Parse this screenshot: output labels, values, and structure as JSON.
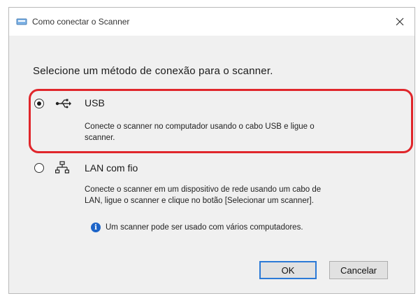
{
  "window": {
    "title": "Como conectar o Scanner",
    "close_glyph": "✕"
  },
  "prompt": "Selecione um método de conexão para o scanner.",
  "options": [
    {
      "icon": "usb-icon",
      "label": "USB",
      "selected": true,
      "desc_lines": [
        "Conecte o scanner no computador usando o cabo USB e ligue o",
        "scanner."
      ]
    },
    {
      "icon": "wired-lan-icon",
      "label": "LAN com fio",
      "selected": false,
      "desc_lines": [
        "Conecte o scanner em um dispositivo de rede usando um cabo de",
        "LAN, ligue o scanner e clique no botão [Selecionar um scanner]."
      ]
    }
  ],
  "info": {
    "icon": "info-icon",
    "glyph": "i",
    "text": "Um scanner pode ser usado com vários computadores."
  },
  "buttons": {
    "ok_label": "OK",
    "cancel_label": "Cancelar"
  },
  "colors": {
    "highlight": "#e0262b",
    "info_blue": "#1d64c8",
    "default_button_border": "#2b79d6"
  }
}
